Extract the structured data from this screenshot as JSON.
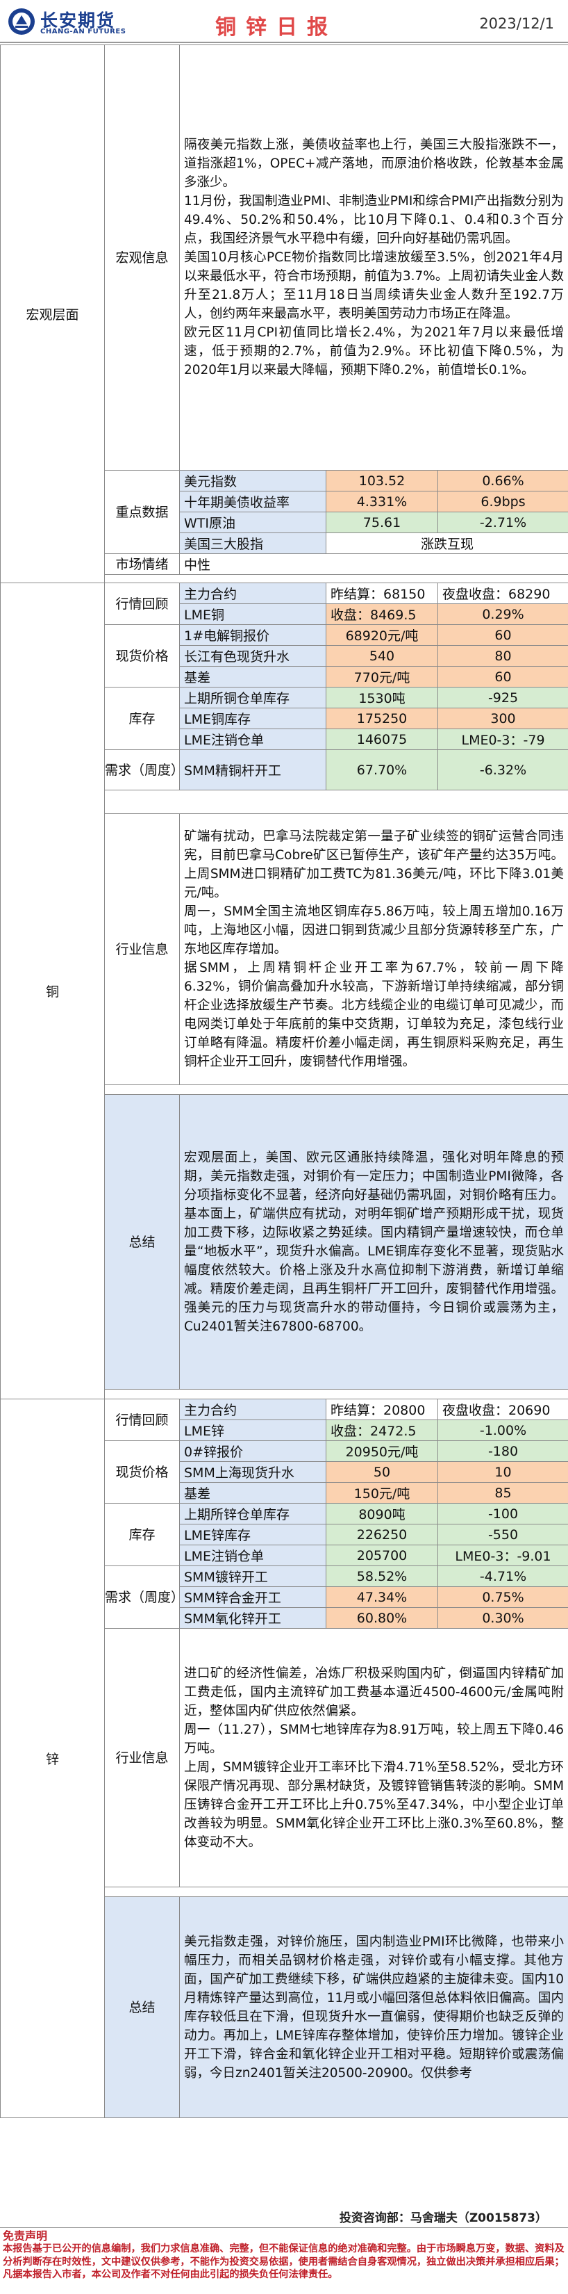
{
  "header": {
    "logo_cn": "长安期货",
    "logo_en": "CHANG-AN FUTURES",
    "title": "铜锌日报",
    "date": "2023/12/1"
  },
  "macro": {
    "section": "宏观层面",
    "news_label": "宏观信息",
    "news_text": "隔夜美元指数上涨，美债收益率也上行，美国三大股指涨跌不一，道指涨超1%，OPEC+减产落地，而原油价格收跌，伦敦基本金属多涨少。\n11月份，我国制造业PMI、非制造业PMI和综合PMI产出指数分别为49.4%、50.2%和50.4%，比10月下降0.1、0.4和0.3个百分点，我国经济景气水平稳中有缓，回升向好基础仍需巩固。\n美国10月核心PCE物价指数同比增速放缓至3.5%，创2021年4月以来最低水平，符合市场预期，前值为3.7%。上周初请失业金人数升至21.8万人；至11月18日当周续请失业金人数升至192.7万人，创约两年来最高水平，表明美国劳动力市场正在降温。\n欧元区11月CPI初值同比增长2.4%，为2021年7月以来最低增速，低于预期的2.7%，前值为2.9%。环比初值下降0.5%，为2020年1月以来最大降幅，预期下降0.2%，前值增长0.1%。",
    "key_label": "重点数据",
    "key_rows": [
      {
        "name": "美元指数",
        "value": "103.52",
        "change": "0.66%"
      },
      {
        "name": "十年期美债收益率",
        "value": "4.331%",
        "change": "6.9bps"
      },
      {
        "name": "WTI原油",
        "value": "75.61",
        "change": "-2.71%"
      },
      {
        "name": "美国三大股指",
        "value": "涨跌互现",
        "change": ""
      }
    ],
    "mood_label": "市场情绪",
    "mood_value": "中性"
  },
  "copper": {
    "section": "铜",
    "market_label": "行情回顾",
    "market_rows": [
      {
        "a": "主力合约",
        "b": "昨结算：68150",
        "c": "夜盘收盘：68290"
      },
      {
        "a": "LME铜",
        "b": "收盘：8469.5",
        "c": "0.29%"
      }
    ],
    "spot_label": "现货价格",
    "spot_rows": [
      {
        "a": "1#电解铜报价",
        "b": "68920元/吨",
        "c": "60"
      },
      {
        "a": "长江有色现货升水",
        "b": "540",
        "c": "80"
      },
      {
        "a": "基差",
        "b": "770元/吨",
        "c": "60"
      }
    ],
    "stock_label": "库存",
    "stock_rows": [
      {
        "a": "上期所铜仓单库存",
        "b": "1530吨",
        "c": "-925"
      },
      {
        "a": "LME铜库存",
        "b": "175250",
        "c": "300"
      },
      {
        "a": "LME注销仓单",
        "b": "146075",
        "c": "LME0-3：-79"
      }
    ],
    "demand_label": "需求（周度）",
    "demand_rows": [
      {
        "a": "SMM精铜杆开工",
        "b": "67.70%",
        "c": "-6.32%"
      }
    ],
    "industry_label": "行业信息",
    "industry_text": "矿端有扰动，巴拿马法院裁定第一量子矿业续签的铜矿运营合同违宪，目前巴拿马Cobre矿区已暂停生产，该矿年产量约达35万吨。上周SMM进口铜精矿加工费TC为81.36美元/吨，环比下降3.01美元/吨。\n周一，SMM全国主流地区铜库存5.86万吨，较上周五增加0.16万吨，上海地区小幅，因进口铜到货减少且部分货源转移至广东，广东地区库存增加。\n据SMM，上周精铜杆企业开工率为67.7%，较前一周下降6.32%，铜价偏高叠加升水较高，下游新增订单持续缩减，部分铜杆企业选择放缓生产节奏。北方线缆企业的电缆订单可见减少，而电网类订单处于年底前的集中交货期，订单较为充足，漆包线行业订单略有降温。精废杆价差小幅走阔，再生铜原料采购充足，再生铜杆企业开工回升，废铜替代作用增强。",
    "summary_label": "总结",
    "summary_text": "宏观层面上，美国、欧元区通胀持续降温，强化对明年降息的预期，美元指数走强，对铜价有一定压力；中国制造业PMI微降，各分项指标变化不显著，经济向好基础仍需巩固，对铜价略有压力。基本面上，矿端供应有扰动，对明年铜矿增产预期形成干扰，现货加工费下移，边际收紧之势延续。国内精铜产量增速较快，而仓单量“地板水平”，现货升水偏高。LME铜库存变化不显著，现货贴水幅度依然较大。价格上涨及升水高位抑制下游消费，新增订单缩减。精废价差走阔，且再生铜杆厂开工回升，废铜替代作用增强。强美元的压力与现货高升水的带动僵持，今日铜价或震荡为主，Cu2401暂关注67800-68700。"
  },
  "zinc": {
    "section": "锌",
    "market_label": "行情回顾",
    "market_rows": [
      {
        "a": "主力合约",
        "b": "昨结算：20800",
        "c": "夜盘收盘：20690"
      },
      {
        "a": "LME锌",
        "b": "收盘：2472.5",
        "c": "-1.00%"
      }
    ],
    "spot_label": "现货价格",
    "spot_rows": [
      {
        "a": "0#锌报价",
        "b": "20950元/吨",
        "c": "-180"
      },
      {
        "a": "SMM上海现货升水",
        "b": "50",
        "c": "10"
      },
      {
        "a": "基差",
        "b": "150元/吨",
        "c": "85"
      }
    ],
    "stock_label": "库存",
    "stock_rows": [
      {
        "a": "上期所锌仓单库存",
        "b": "8090吨",
        "c": "-100"
      },
      {
        "a": "LME锌库存",
        "b": "226250",
        "c": "-550"
      },
      {
        "a": "LME注销仓单",
        "b": "205700",
        "c": "LME0-3：-9.01"
      }
    ],
    "demand_label": "需求（周度）",
    "demand_rows": [
      {
        "a": "SMM镀锌开工",
        "b": "58.52%",
        "c": "-4.71%"
      },
      {
        "a": "SMM锌合金开工",
        "b": "47.34%",
        "c": "0.75%"
      },
      {
        "a": "SMM氧化锌开工",
        "b": "60.80%",
        "c": "0.30%"
      }
    ],
    "industry_label": "行业信息",
    "industry_text": "进口矿的经济性偏差，冶炼厂积极采购国内矿，倒逼国内锌精矿加工费走低，国内主流锌矿加工费基本逼近4500-4600元/金属吨附近，整体国内矿供应依然偏紧。\n周一（11.27），SMM七地锌库存为8.91万吨，较上周五下降0.46万吨。\n上周，SMM镀锌企业开工率环比下滑4.71%至58.52%，受北方环保限产情况再现、部分黑材缺货，及镀锌管销售转淡的影响。SMM压铸锌合金开工开工环比上升0.75%至47.34%，中小型企业订单改善较为明显。SMM氧化锌企业开工环比上涨0.3%至60.8%，整体变动不大。",
    "summary_label": "总结",
    "summary_text": "美元指数走强，对锌价施压，国内制造业PMI环比微降，也带来小幅压力，而相关品钢材价格走强，对锌价或有小幅支撑。其他方面，国产矿加工费继续下移，矿端供应趋紧的主旋律未变。国内10月精炼锌产量达到高位，11月或小幅回落但总体料依旧偏高。国内库存较低且在下滑，但现货升水一直偏弱，使得期价也缺乏反弹的动力。再加上，LME锌库存整体增加，使锌价压力增加。镀锌企业开工下滑，锌合金和氧化锌企业开工相对平稳。短期锌价或震荡偏弱，今日zn2401暂关注20500-20900。仅供参考"
  },
  "footer": {
    "author": "投资咨询部：马舍瑞夫（Z0015873）",
    "disclaimer_title": "免责声明",
    "disclaimer_text": "本报告基于已公开的信息编制，我们力求信息准确、完整，但不能保证信息的绝对准确和完整。由于市场瞬息万变，数据、资料及分析判断存在时效性，文中建议仅供参考，不能作为投资交易依据，使用者需结合自身客观情况，独立做出决策并承担相应后果；凡据本报告入市者，本公司及作者不对任何由此引起的损失负任何法律责任。"
  },
  "colors": {
    "title_red": "#e04848",
    "brand_blue": "#1b3f8f",
    "cell_orange": "#fbd2b0",
    "cell_green": "#d6ecd1",
    "cell_blue": "#dbe6f5",
    "disclaimer_red": "#c0202a"
  }
}
